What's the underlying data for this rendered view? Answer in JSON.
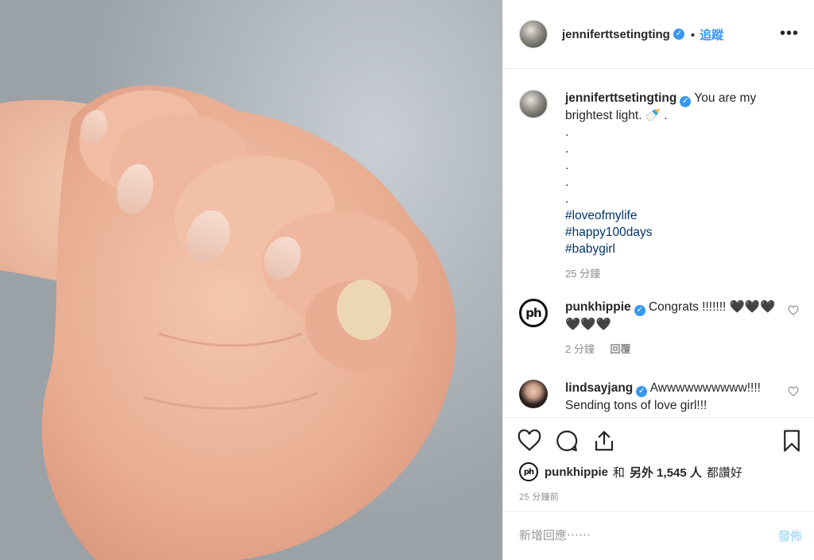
{
  "photo": {
    "alt_icon": "baby-hand-holding-finger-photo"
  },
  "header": {
    "username": "jenniferttsetingting",
    "verified_mark": "✓",
    "separator": "•",
    "follow_label": "追蹤",
    "more_label": "•••"
  },
  "caption": {
    "username": "jenniferttsetingting",
    "text": "You are my brightest light. 🍼 .",
    "dots": [
      ".",
      ".",
      ".",
      ".",
      "."
    ],
    "hashtags": [
      "#loveofmylife",
      "#happy100days",
      "#babygirl"
    ],
    "time": "25 分鐘"
  },
  "comments": [
    {
      "username": "punkhippie",
      "avatar_text": "ph",
      "text": "Congrats !!!!!!! 🖤🖤🖤🖤🖤🖤",
      "time": "2 分鐘",
      "reply_label": "回覆"
    },
    {
      "username": "lindsayjang",
      "text": "Awwwwwwwwww!!!! Sending tons of love girl!!!"
    }
  ],
  "actions": {
    "like_icon": "heart-icon",
    "comment_icon": "comment-icon",
    "share_icon": "share-icon",
    "save_icon": "bookmark-icon"
  },
  "likes": {
    "avatar_text": "ph",
    "user": "punkhippie",
    "and": "和",
    "others": "另外 1,545 人",
    "suffix": "都讚好"
  },
  "timestamp": "25 分鐘前",
  "add_comment": {
    "placeholder": "新增回應⋯⋯",
    "post_label": "發佈"
  },
  "colors": {
    "link_blue": "#3897f0",
    "hashtag": "#003569",
    "muted": "#8e8e8e",
    "post_disabled": "#b2dffc"
  }
}
